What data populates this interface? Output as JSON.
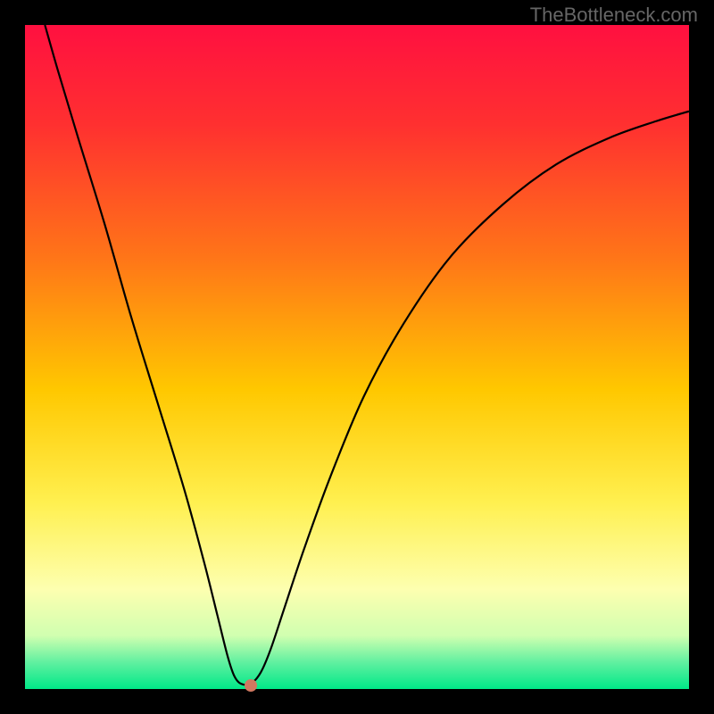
{
  "watermark": "TheBottleneck.com",
  "chart_data": {
    "type": "line",
    "title": "",
    "xlabel": "",
    "ylabel": "",
    "xlim": [
      0,
      100
    ],
    "ylim": [
      0,
      100
    ],
    "background_gradient": {
      "stops": [
        {
          "pos": 0.0,
          "color": "#ff1040"
        },
        {
          "pos": 0.15,
          "color": "#ff3030"
        },
        {
          "pos": 0.35,
          "color": "#ff7518"
        },
        {
          "pos": 0.55,
          "color": "#ffc800"
        },
        {
          "pos": 0.72,
          "color": "#fff050"
        },
        {
          "pos": 0.85,
          "color": "#fdffb0"
        },
        {
          "pos": 0.92,
          "color": "#d0ffb0"
        },
        {
          "pos": 0.96,
          "color": "#60f0a0"
        },
        {
          "pos": 1.0,
          "color": "#00e888"
        }
      ]
    },
    "series": [
      {
        "name": "bottleneck-curve",
        "color": "#000000",
        "width": 2.2,
        "points": [
          {
            "x": 3,
            "y": 100
          },
          {
            "x": 5,
            "y": 93
          },
          {
            "x": 8,
            "y": 83
          },
          {
            "x": 12,
            "y": 70
          },
          {
            "x": 16,
            "y": 56
          },
          {
            "x": 20,
            "y": 43
          },
          {
            "x": 24,
            "y": 30
          },
          {
            "x": 27,
            "y": 19
          },
          {
            "x": 29,
            "y": 11
          },
          {
            "x": 30.5,
            "y": 5
          },
          {
            "x": 31.5,
            "y": 2
          },
          {
            "x": 32.5,
            "y": 0.8
          },
          {
            "x": 34,
            "y": 0.8
          },
          {
            "x": 35.5,
            "y": 2.5
          },
          {
            "x": 37,
            "y": 6
          },
          {
            "x": 39,
            "y": 12
          },
          {
            "x": 42,
            "y": 21
          },
          {
            "x": 46,
            "y": 32
          },
          {
            "x": 51,
            "y": 44
          },
          {
            "x": 57,
            "y": 55
          },
          {
            "x": 64,
            "y": 65
          },
          {
            "x": 72,
            "y": 73
          },
          {
            "x": 80,
            "y": 79
          },
          {
            "x": 88,
            "y": 83
          },
          {
            "x": 95,
            "y": 85.5
          },
          {
            "x": 100,
            "y": 87
          }
        ]
      }
    ],
    "markers": [
      {
        "name": "optimum-point",
        "x": 34,
        "y": 0.5,
        "color": "#d07860"
      }
    ]
  }
}
